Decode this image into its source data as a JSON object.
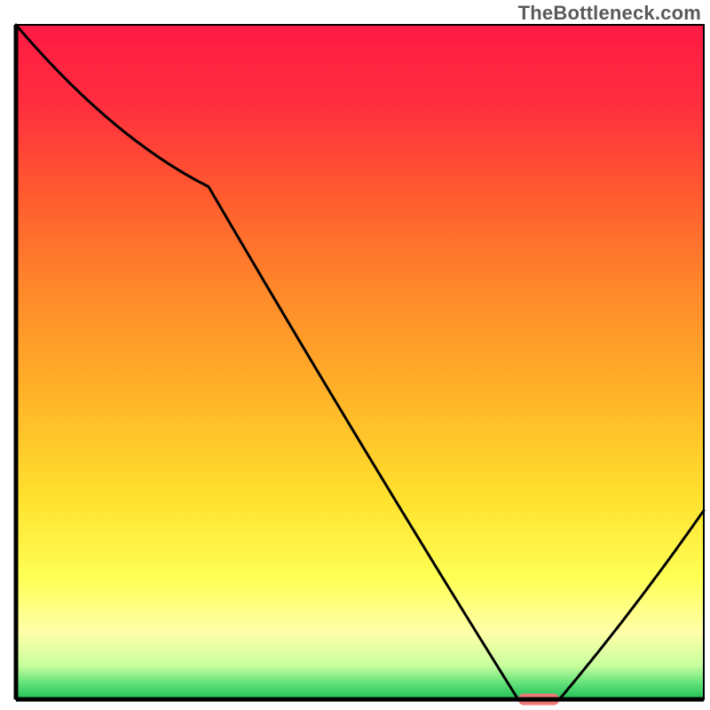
{
  "watermark": "TheBottleneck.com",
  "chart_data": {
    "type": "line",
    "title": "",
    "xlabel": "",
    "ylabel": "",
    "xlim": [
      0,
      100
    ],
    "ylim": [
      0,
      100
    ],
    "x": [
      0,
      28,
      73,
      79,
      100
    ],
    "values": [
      100,
      76,
      0,
      0,
      28
    ],
    "indicator": {
      "x_start": 73,
      "x_end": 79,
      "y": 0,
      "color": "#f07878"
    },
    "colors": {
      "gradient_stops": [
        {
          "offset": 0.0,
          "color": "#ff1a44"
        },
        {
          "offset": 0.12,
          "color": "#ff2f3e"
        },
        {
          "offset": 0.25,
          "color": "#ff5a2f"
        },
        {
          "offset": 0.4,
          "color": "#ff8a2a"
        },
        {
          "offset": 0.55,
          "color": "#ffb328"
        },
        {
          "offset": 0.7,
          "color": "#ffe12e"
        },
        {
          "offset": 0.82,
          "color": "#ffff55"
        },
        {
          "offset": 0.9,
          "color": "#ffffa8"
        },
        {
          "offset": 0.95,
          "color": "#c8ff9e"
        },
        {
          "offset": 0.975,
          "color": "#66e37a"
        },
        {
          "offset": 1.0,
          "color": "#1fbf57"
        }
      ],
      "curve": "#000000",
      "frame": "#000000"
    }
  }
}
